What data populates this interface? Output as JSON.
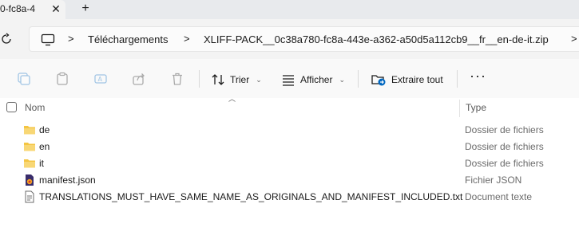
{
  "tab": {
    "title": "0-fc8a-4",
    "close": "✕",
    "new": "+"
  },
  "address": {
    "breadcrumbs": [
      "Téléchargements",
      "XLIFF-PACK__0c38a780-fc8a-443e-a362-a50d5a112cb9__fr__en-de-it.zip"
    ],
    "separator": ">"
  },
  "toolbar": {
    "sort_label": "Trier",
    "view_label": "Afficher",
    "extract_label": "Extraire tout",
    "more": "···"
  },
  "columns": {
    "name": "Nom",
    "type": "Type"
  },
  "files": [
    {
      "name": "de",
      "type": "Dossier de fichiers",
      "icon": "folder-icon"
    },
    {
      "name": "en",
      "type": "Dossier de fichiers",
      "icon": "folder-icon"
    },
    {
      "name": "it",
      "type": "Dossier de fichiers",
      "icon": "folder-icon"
    },
    {
      "name": "manifest.json",
      "type": "Fichier JSON",
      "icon": "json-file-icon"
    },
    {
      "name": "TRANSLATIONS_MUST_HAVE_SAME_NAME_AS_ORIGINALS_AND_MANIFEST_INCLUDED.txt",
      "type": "Document texte",
      "icon": "text-file-icon"
    }
  ],
  "colors": {
    "folder": "#f4c542",
    "accent": "#0067c0"
  }
}
